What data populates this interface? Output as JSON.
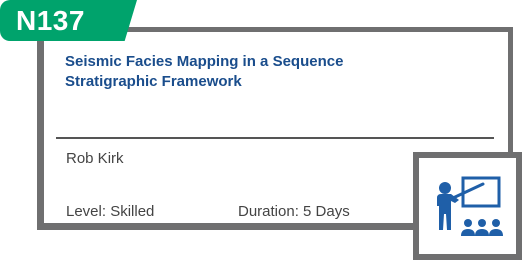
{
  "course": {
    "code": "N137",
    "title_line1": "Seismic Facies Mapping in a Sequence",
    "title_line2": "Stratigraphic Framework",
    "instructor": "Rob Kirk",
    "level": "Level: Skilled",
    "duration": "Duration: 5 Days"
  },
  "icons": {
    "format": "classroom-presentation-icon"
  },
  "colors": {
    "tab_green": "#00a36c",
    "title_blue": "#1a4d8c",
    "border_gray": "#6f6f70",
    "icon_blue": "#1f5fa8"
  }
}
